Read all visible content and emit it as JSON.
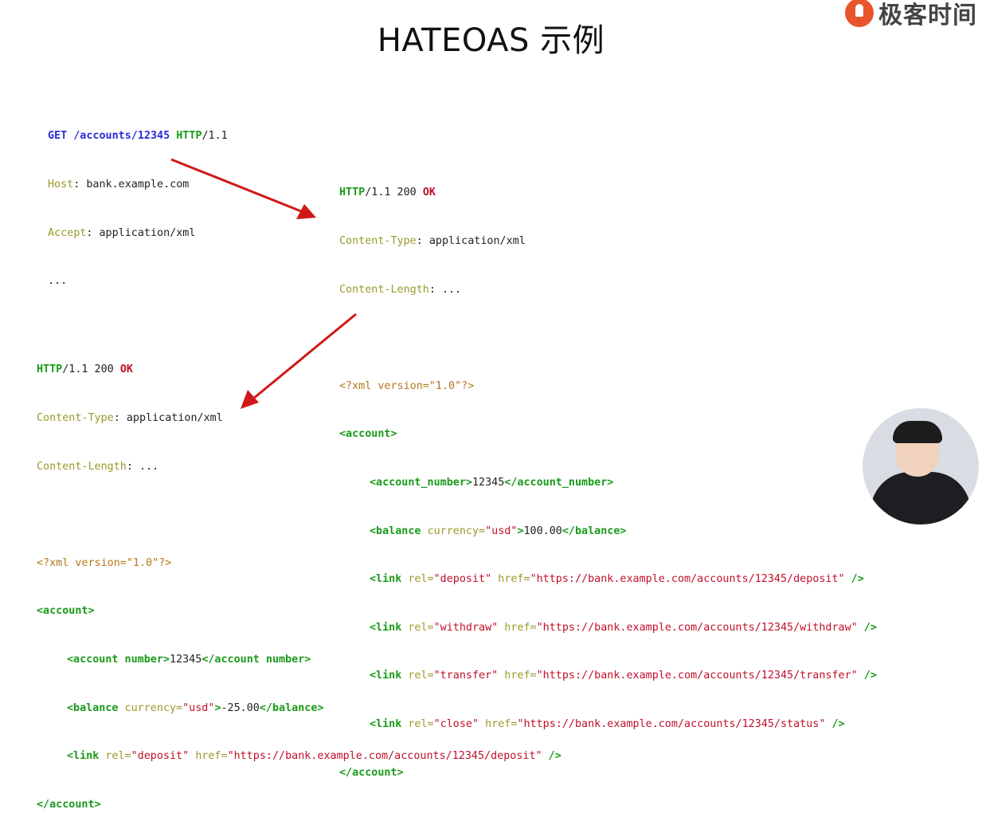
{
  "slide": {
    "title": "HATEOAS 示例",
    "logo_text": "极客时间",
    "logo_icon": "geektime-logo-icon"
  },
  "request": {
    "line1": {
      "method": "GET",
      "path": "/accounts/12345",
      "proto": "HTTP",
      "ver": "/1.1"
    },
    "host_key": "Host",
    "host_val": ": bank.example.com",
    "accept_key": "Accept",
    "accept_val": ": application/xml",
    "more": "..."
  },
  "response1": {
    "status": {
      "proto": "HTTP",
      "ver": "/1.1 200 ",
      "text": "OK"
    },
    "ctype_key": "Content-Type",
    "ctype_val": ": application/xml",
    "clen_key": "Content-Length",
    "clen_val": ": ...",
    "xml_decl": "<?xml version=\"1.0\"?>",
    "open_account": "<account>",
    "account_number": {
      "open": "<account_number>",
      "value": "12345",
      "close": "</account_number>"
    },
    "balance": {
      "open": "<balance",
      "attr": " currency=",
      "attr_val": "\"usd\"",
      "gt": ">",
      "value": "100.00",
      "close": "</balance>"
    },
    "links": [
      {
        "open": "<link",
        "rel_attr": " rel=",
        "rel": "\"deposit\"",
        "href_attr": " href=",
        "href": "\"https://bank.example.com/accounts/12345/deposit\"",
        "end": " />"
      },
      {
        "open": "<link",
        "rel_attr": " rel=",
        "rel": "\"withdraw\"",
        "href_attr": " href=",
        "href": "\"https://bank.example.com/accounts/12345/withdraw\"",
        "end": " />"
      },
      {
        "open": "<link",
        "rel_attr": " rel=",
        "rel": "\"transfer\"",
        "href_attr": " href=",
        "href": "\"https://bank.example.com/accounts/12345/transfer\"",
        "end": " />"
      },
      {
        "open": "<link",
        "rel_attr": " rel=",
        "rel": "\"close\"",
        "href_attr": " href=",
        "href": "\"https://bank.example.com/accounts/12345/status\"",
        "end": " />"
      }
    ],
    "close_account": "</account>"
  },
  "response2": {
    "status": {
      "proto": "HTTP",
      "ver": "/1.1 200 ",
      "text": "OK"
    },
    "ctype_key": "Content-Type",
    "ctype_val": ": application/xml",
    "clen_key": "Content-Length",
    "clen_val": ": ...",
    "xml_decl": "<?xml version=\"1.0\"?>",
    "open_account": "<account>",
    "account_number": {
      "open": "<account number>",
      "value": "12345",
      "close": "</account number>"
    },
    "balance": {
      "open": "<balance",
      "attr": " currency=",
      "attr_val": "\"usd\"",
      "gt": ">",
      "value": "-25.00",
      "close": "</balance>"
    },
    "link": {
      "open": "<link",
      "rel_attr": " rel=",
      "rel": "\"deposit\"",
      "href_attr": " href=",
      "href": "\"https://bank.example.com/accounts/12345/deposit\"",
      "end": " />"
    },
    "close_account": "</account>"
  },
  "colors": {
    "arrow": "#d01818",
    "tag": "#1a9a1a",
    "keyword": "#2b2bd8",
    "value": "#c0102a"
  }
}
